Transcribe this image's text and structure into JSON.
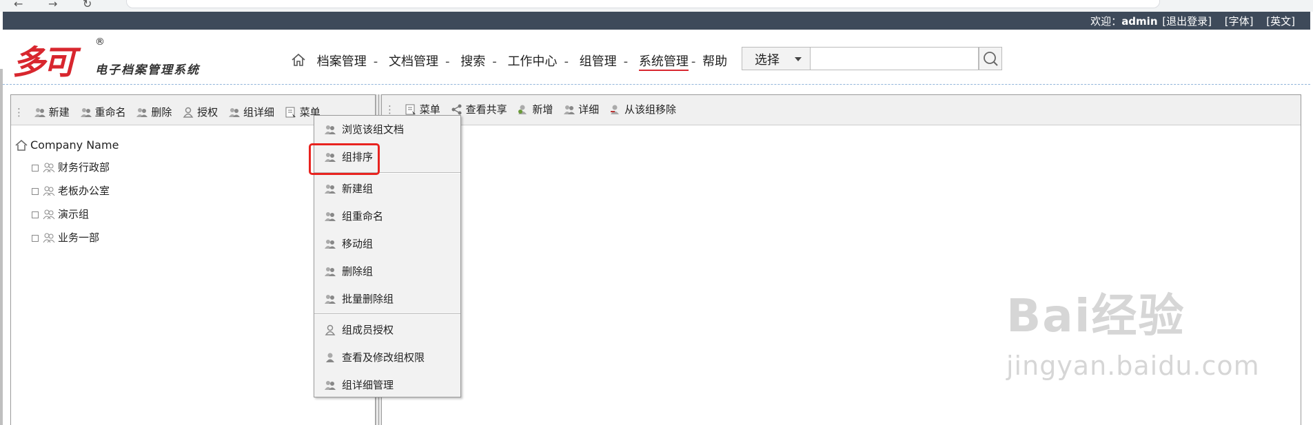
{
  "topbar": {
    "welcome": "欢迎：",
    "user": "admin",
    "logout": "[退出登录]",
    "font": "[字体]",
    "english": "[英文]"
  },
  "logo": {
    "mark": "多可",
    "reg": "®",
    "subtitle": "电子档案管理系统"
  },
  "nav": {
    "items": [
      "档案管理",
      "文档管理",
      "搜索",
      "工作中心",
      "组管理",
      "系统管理",
      "帮助"
    ],
    "separator": "-",
    "active_index": 5
  },
  "search": {
    "select_value": "选择",
    "input_value": ""
  },
  "left_toolbar": {
    "buttons": [
      "新建",
      "重命名",
      "删除",
      "授权",
      "组详细",
      "菜单"
    ]
  },
  "right_toolbar": {
    "buttons": [
      "菜单",
      "查看共享",
      "新增",
      "详细",
      "从该组移除"
    ]
  },
  "tree": {
    "root": "Company Name",
    "nodes": [
      "财务行政部",
      "老板办公室",
      "演示组",
      "业务一部"
    ]
  },
  "context_menu": {
    "items": [
      "浏览该组文档",
      "组排序",
      "新建组",
      "组重命名",
      "移动组",
      "删除组",
      "批量删除组",
      "组成员授权",
      "查看及修改组权限",
      "组详细管理"
    ],
    "highlighted": "组排序"
  },
  "watermark": {
    "line1": "Bai经验",
    "line2": "jingyan.baidu.com"
  },
  "colors": {
    "topbar_bg": "#3e4a5a",
    "brand_red": "#d8262e",
    "highlight_border": "#e8231f"
  }
}
